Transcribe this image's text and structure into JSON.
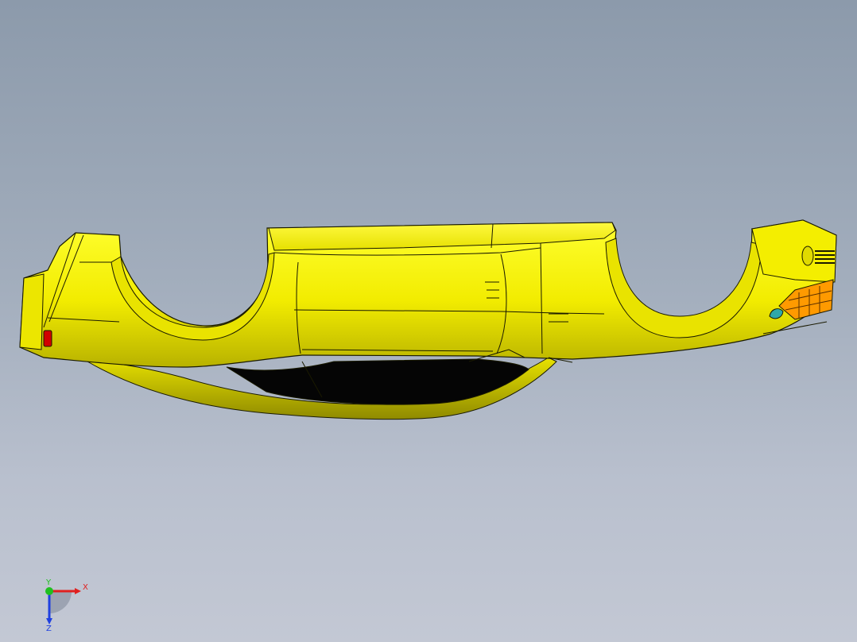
{
  "viewport": {
    "background_top": "#8c9aab",
    "background_bottom": "#c3c8d4"
  },
  "model": {
    "body_color": "#f5f000",
    "body_shadow": "#c9c400",
    "edge_color": "#1a1a00",
    "cavity_color": "#050505",
    "taillight_color": "#d10000",
    "headlight_color": "#ff9a00",
    "lens_color": "#2fa8a8"
  },
  "triad": {
    "x_label": "X",
    "y_label": "Y",
    "z_label": "Z",
    "x_color": "#e02020",
    "y_color": "#20c020",
    "z_color": "#2040e0"
  }
}
